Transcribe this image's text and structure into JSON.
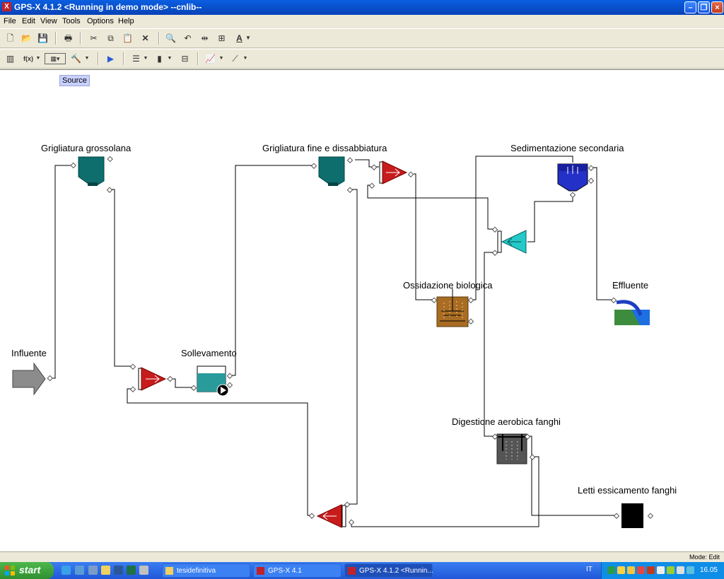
{
  "window": {
    "title": "GPS-X 4.1.2 <Running in demo mode> --cnlib--",
    "app_icon": "X"
  },
  "menu": [
    {
      "id": "file",
      "label": "File"
    },
    {
      "id": "edit",
      "label": "Edit"
    },
    {
      "id": "view",
      "label": "View"
    },
    {
      "id": "tools",
      "label": "Tools"
    },
    {
      "id": "options",
      "label": "Options"
    },
    {
      "id": "help",
      "label": "Help"
    }
  ],
  "toolbar2": {
    "fx_label": "f(x)"
  },
  "tooltip": "Source",
  "labels": {
    "influente": "Influente",
    "grigliatura_grossolana": "Grigliatura grossolana",
    "sollevamento": "Sollevamento",
    "grigliatura_fine": "Grigliatura fine e dissabbiatura",
    "sedimentazione": "Sedimentazione secondaria",
    "ossidazione": "Ossidazione biologica",
    "effluente": "Effluente",
    "digestione": "Digestione aerobica fanghi",
    "letti": "Letti essicamento fanghi"
  },
  "status": {
    "mode": "Mode: Edit"
  },
  "taskbar": {
    "start": "start",
    "tasks": [
      {
        "id": "folder",
        "label": "tesidefinitiva"
      },
      {
        "id": "gpsx",
        "label": "GPS-X 4.1"
      },
      {
        "id": "gpsx-running",
        "label": "GPS-X 4.1.2 <Runnin..."
      }
    ],
    "language": "IT",
    "clock": "16.05"
  },
  "colors": {
    "clarifier_teal": "#0e6e6e",
    "splitter_red": "#c81c1c",
    "mixer_cyan": "#26c8c8",
    "tank_brown": "#a86c22",
    "digester_grey": "#555555",
    "settler_blue": "#2431c8",
    "pump_teal": "#2a9b9b"
  }
}
